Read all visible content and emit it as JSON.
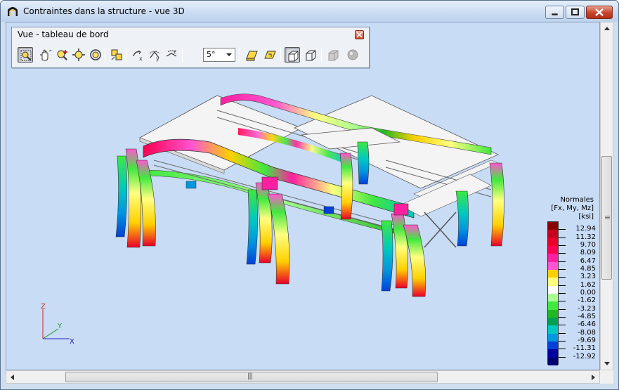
{
  "window": {
    "title": "Contraintes dans la structure - vue 3D"
  },
  "toolbar": {
    "title": "Vue - tableau de bord",
    "angle_value": "5°",
    "buttons": [
      {
        "name": "zoom-window-icon",
        "active": true
      },
      {
        "name": "pan-hand-icon",
        "active": false
      },
      {
        "name": "zoom-in-icon",
        "active": false
      },
      {
        "name": "zoom-extent-icon",
        "active": false
      },
      {
        "name": "rotate-icon",
        "active": false
      },
      {
        "name": "select-view-icon",
        "active": false
      },
      {
        "name": "rotate-x-icon",
        "active": false
      },
      {
        "name": "rotate-y-icon",
        "active": false
      },
      {
        "name": "rotate-z-icon",
        "active": false
      },
      {
        "name": "view-front-icon",
        "active": false
      },
      {
        "name": "view-back-icon",
        "active": false
      },
      {
        "name": "solid-view-icon",
        "active": true
      },
      {
        "name": "wire-view-icon",
        "active": false
      },
      {
        "name": "render-icon",
        "active": false
      },
      {
        "name": "sphere-icon",
        "active": false
      }
    ]
  },
  "axes": {
    "x": "X",
    "y": "Y",
    "z": "Z"
  },
  "legend": {
    "title_line1": "Normales",
    "title_line2": "[Fx, My, Mz]",
    "unit": "[ksi]",
    "values": [
      "12.94",
      "11.32",
      "9.70",
      "8.09",
      "6.47",
      "4.85",
      "3.23",
      "1.62",
      "0.00",
      "-1.62",
      "-3.23",
      "-4.85",
      "-6.46",
      "-8.08",
      "-9.69",
      "-11.31",
      "-12.92"
    ],
    "colors": [
      "#8b0000",
      "#c8001e",
      "#e8002a",
      "#ff0050",
      "#ff1fa0",
      "#ff55d0",
      "#ffd000",
      "#ffff80",
      "#ffffff",
      "#a8ff90",
      "#40e840",
      "#22b822",
      "#00a050",
      "#00c8c0",
      "#0096e0",
      "#0040d8",
      "#0000a0",
      "#000070"
    ]
  },
  "scrollbar": {
    "grip": "|||"
  }
}
